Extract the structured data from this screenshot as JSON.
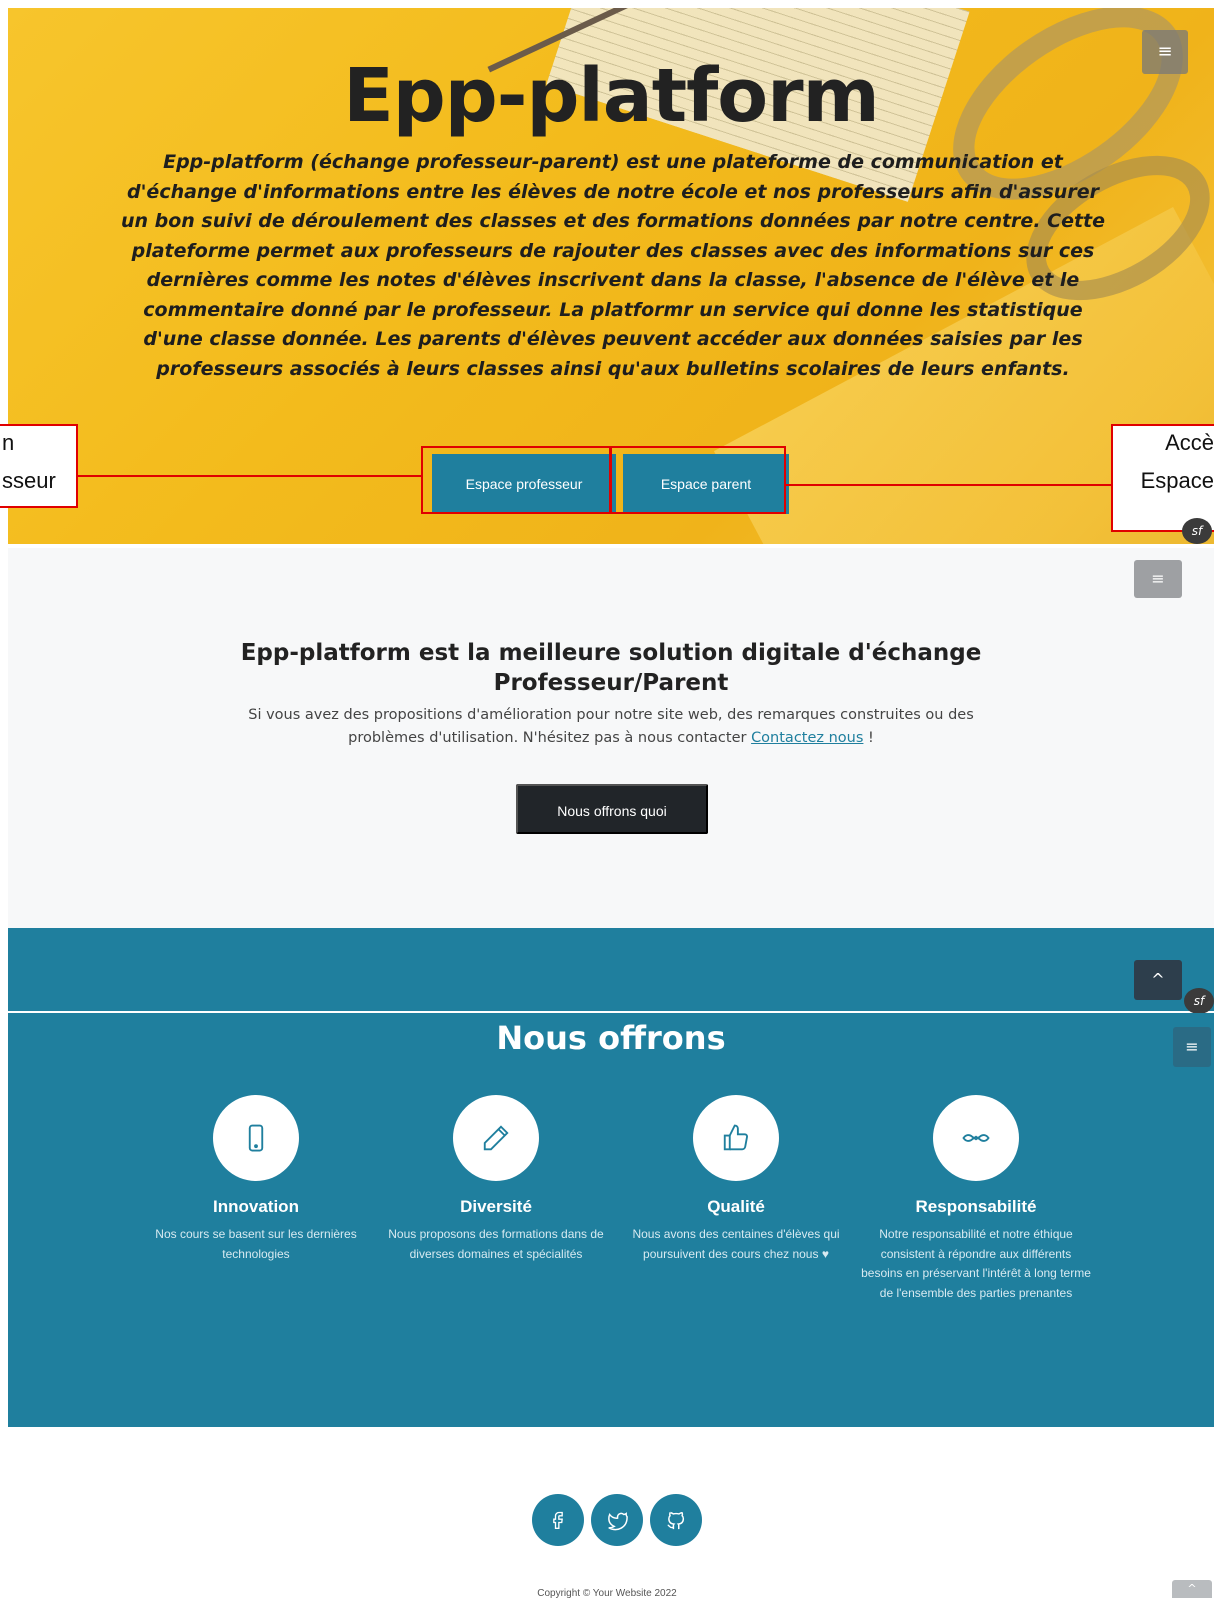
{
  "hero": {
    "title": "Epp-platform",
    "description": "Epp-platform (échange professeur-parent) est une plateforme de communication et d'échange d'informations entre les élèves de notre école et nos professeurs afin d'assurer un bon suivi de déroulement des classes et des formations données par notre centre. Cette plateforme permet aux professeurs de rajouter des classes avec des informations sur ces dernières comme les notes d'élèves inscrivent dans la classe, l'absence de l'élève et le commentaire donné par le professeur. La platformr un service qui donne les statistique d'une classe donnée. Les parents d'élèves peuvent accéder aux données saisies par les professeurs associés à leurs classes ainsi qu'aux bulletins scolaires de leurs enfants.",
    "menu_icon": "≡",
    "buttons": {
      "professor": "Espace professeur",
      "parent": "Espace parent"
    },
    "annotation_left_line1": "n",
    "annotation_left_line2": "sseur",
    "annotation_right_line1": "Accè",
    "annotation_right_line2": "Espace",
    "badge": "sf"
  },
  "section2": {
    "title_line1": "Epp-platform est la meilleure solution digitale d'échange",
    "title_line2": "Professeur/Parent",
    "text": "Si vous avez des propositions d'amélioration pour notre site web, des remarques construites ou des problèmes d'utilisation. N'hésitez pas à nous contacter",
    "link": "Contactez nous",
    "text_end": " !",
    "button": "Nous offrons quoi",
    "menu_icon": "≡"
  },
  "strip": {
    "up_icon": "^",
    "badge": "sf"
  },
  "offers": {
    "title": "Nous offrons",
    "menu_icon": "≡",
    "items": [
      {
        "title": "Innovation",
        "text": "Nos cours se basent sur les dernières technologies",
        "icon": "phone-icon"
      },
      {
        "title": "Diversité",
        "text": "Nous proposons des formations dans de diverses domaines et spécialités",
        "icon": "pencil-icon"
      },
      {
        "title": "Qualité",
        "text": "Nous avons des centaines d'élèves qui poursuivent des cours chez nous ♥",
        "icon": "thumbs-up-icon"
      },
      {
        "title": "Responsabilité",
        "text": "Notre responsabilité et notre éthique consistent à répondre aux différents besoins en préservant l'intérêt à long terme de l'ensemble des parties prenantes",
        "icon": "mustache-icon"
      }
    ]
  },
  "footer": {
    "socials": [
      "facebook-icon",
      "twitter-icon",
      "github-icon"
    ],
    "copyright": "Copyright © Your Website 2022",
    "up_icon": "^"
  },
  "colors": {
    "teal": "#1f7f9e",
    "hero_yellow": "#f3bb1c",
    "dark": "#212529",
    "annotation": "#e00000"
  }
}
